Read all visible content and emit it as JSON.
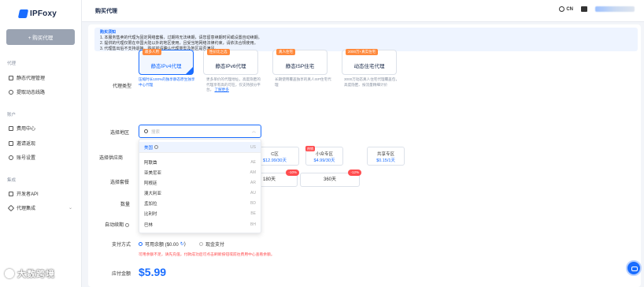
{
  "app": {
    "logo_text": "IPFoxy",
    "buy_button": "+ 购买代理"
  },
  "sidebar": {
    "sections": [
      {
        "title": "代理",
        "items": [
          "静态代理管理",
          "提取动态线路"
        ]
      },
      {
        "title": "账户",
        "items": [
          "费用中心",
          "邀请返现",
          "账号设置"
        ]
      },
      {
        "title": "集成",
        "items": [
          "开发者API",
          "代理集成"
        ]
      }
    ]
  },
  "header": {
    "title": "购买代理",
    "language": "CN"
  },
  "notice": {
    "title": "购买须知",
    "lines": [
      "1. 本服务售卖的代理为固定网络套餐，过期将无法续期，请您留意续期时间或设置自动续期。",
      "2. 提供的代理仅限在中国大陆以外的地区使用，且受当地网络法律约束，请依法合规使用。",
      "3. 代理售出后不支持退换，购买前请确认代理类型及地区是否满足。"
    ]
  },
  "form": {
    "proxy_type_label": "代理类型",
    "region_label": "选择地区",
    "provider_label": "选择供应商",
    "package_label": "选择套餐",
    "quantity_label": "数量",
    "auto_renew_label": "自动续期",
    "payment_label": "支付方式",
    "total_label": "应付金额"
  },
  "proxy_types": [
    {
      "tag": "最多人用",
      "name": "静态IPv4代理",
      "desc": "压缩时长100%的独享静态原生独享中心代理",
      "active": true
    },
    {
      "tag": "性价比之选",
      "name": "静态IPv6代理",
      "desc": "更多单价的代理地址，高度隐匿的代理享有高的可在，仅支持部分平台。",
      "link": "了解更多",
      "active": false
    },
    {
      "tag": "真人住宅",
      "name": "静态ISP住宅",
      "desc": "长期使用覆盖独享的真人ISP住宅代理",
      "active": false
    },
    {
      "tag": "2000万+真实住宅",
      "name": "动态住宅代理",
      "desc": "3000万动态真人住宅代理覆盖包，高度隐匿、按流量精细计价",
      "active": false
    }
  ],
  "region": {
    "placeholder": "搜索",
    "options": [
      {
        "name": "美国",
        "code": "US",
        "selected": true
      },
      {
        "name": "阿联酋",
        "code": "AE"
      },
      {
        "name": "亚美尼亚",
        "code": "AM"
      },
      {
        "name": "阿根廷",
        "code": "AR"
      },
      {
        "name": "澳大利亚",
        "code": "AU"
      },
      {
        "name": "孟加拉",
        "code": "BD"
      },
      {
        "name": "比利时",
        "code": "BE"
      },
      {
        "name": "巴林",
        "code": "BH"
      }
    ]
  },
  "plans": [
    {
      "name": "C区",
      "price": "$12.99/30天",
      "hot": ""
    },
    {
      "name": "小众专区",
      "price": "$4.99/30天",
      "hot": "热销"
    },
    {
      "name": "共享专区",
      "price": "$0.15/1天",
      "hot": ""
    }
  ],
  "periods": [
    {
      "label": "180天",
      "discount": "-10%"
    },
    {
      "label": "360天",
      "discount": "-12%"
    }
  ],
  "payment": {
    "balance_option": "可用余额 ($0.00",
    "cash_option": "现金支付",
    "note": "可用余额不足，请先充值，付款成功后可点击刷新按钮或前往费用中心查看余额。"
  },
  "total": "$5.99",
  "watermark": "大数跨境",
  "colors": {
    "primary": "#1a6dff",
    "danger": "#ff4d4f",
    "tag": "#ff8a3d"
  }
}
